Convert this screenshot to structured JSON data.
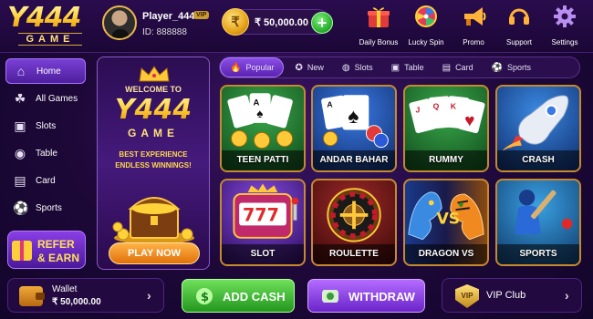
{
  "brand": {
    "logo_text": "Y444",
    "logo_sub": "GAME"
  },
  "player": {
    "name": "Player_444",
    "vip_badge": "VIP",
    "id_text": "ID: 888888"
  },
  "balance": {
    "value": "₹ 50,000.00",
    "coin_symbol": "₹",
    "add_symbol": "+"
  },
  "top_actions": [
    {
      "label": "Daily Bonus",
      "icon": "gift-icon"
    },
    {
      "label": "Lucky Spin",
      "icon": "wheel-icon"
    },
    {
      "label": "Promo",
      "icon": "megaphone-icon"
    },
    {
      "label": "Support",
      "icon": "headset-icon"
    },
    {
      "label": "Settings",
      "icon": "gear-icon"
    }
  ],
  "sidebar": {
    "items": [
      {
        "label": "Home",
        "icon": "home-icon",
        "active": true
      },
      {
        "label": "All Games",
        "icon": "grid-icon"
      },
      {
        "label": "Slots",
        "icon": "slot-icon"
      },
      {
        "label": "Table",
        "icon": "table-icon"
      },
      {
        "label": "Card",
        "icon": "card-icon"
      },
      {
        "label": "Sports",
        "icon": "ball-icon"
      }
    ],
    "refer_line1": "REFER",
    "refer_line2": "& EARN"
  },
  "banner": {
    "welcome": "WELCOME TO",
    "logo_text": "Y444",
    "logo_sub": "GAME",
    "tagline1": "BEST EXPERIENCE",
    "tagline2": "ENDLESS WINNINGS!",
    "cta": "PLAY NOW"
  },
  "tabs": [
    {
      "label": "Popular",
      "icon": "fire-icon",
      "active": true
    },
    {
      "label": "New",
      "icon": "star-icon"
    },
    {
      "label": "Slots",
      "icon": "slot-icon"
    },
    {
      "label": "Table",
      "icon": "table-icon"
    },
    {
      "label": "Card",
      "icon": "card-icon"
    },
    {
      "label": "Sports",
      "icon": "ball-icon"
    }
  ],
  "games": [
    {
      "label": "TEEN PATTI",
      "theme": "#2a7a3a"
    },
    {
      "label": "ANDAR BAHAR",
      "theme": "#1f5aa0"
    },
    {
      "label": "RUMMY",
      "theme": "#2a7a3a"
    },
    {
      "label": "CRASH",
      "theme": "#1c4fb0"
    },
    {
      "label": "SLOT",
      "theme": "#5a1f9c"
    },
    {
      "label": "ROULETTE",
      "theme": "#7a1a1a"
    },
    {
      "label": "DRAGON VS TIGER",
      "theme": "#1a2a6a"
    },
    {
      "label": "SPORTS",
      "theme": "#1a6aa8"
    }
  ],
  "footer": {
    "wallet_label": "Wallet",
    "wallet_value": "₹ 50,000.00",
    "add_cash": "ADD CASH",
    "withdraw": "WITHDRAW",
    "vip_label": "VIP Club",
    "vip_badge": "VIP"
  },
  "colors": {
    "accent_purple": "#7a3fd6",
    "gold": "#ffd23a",
    "green": "#23961f"
  }
}
